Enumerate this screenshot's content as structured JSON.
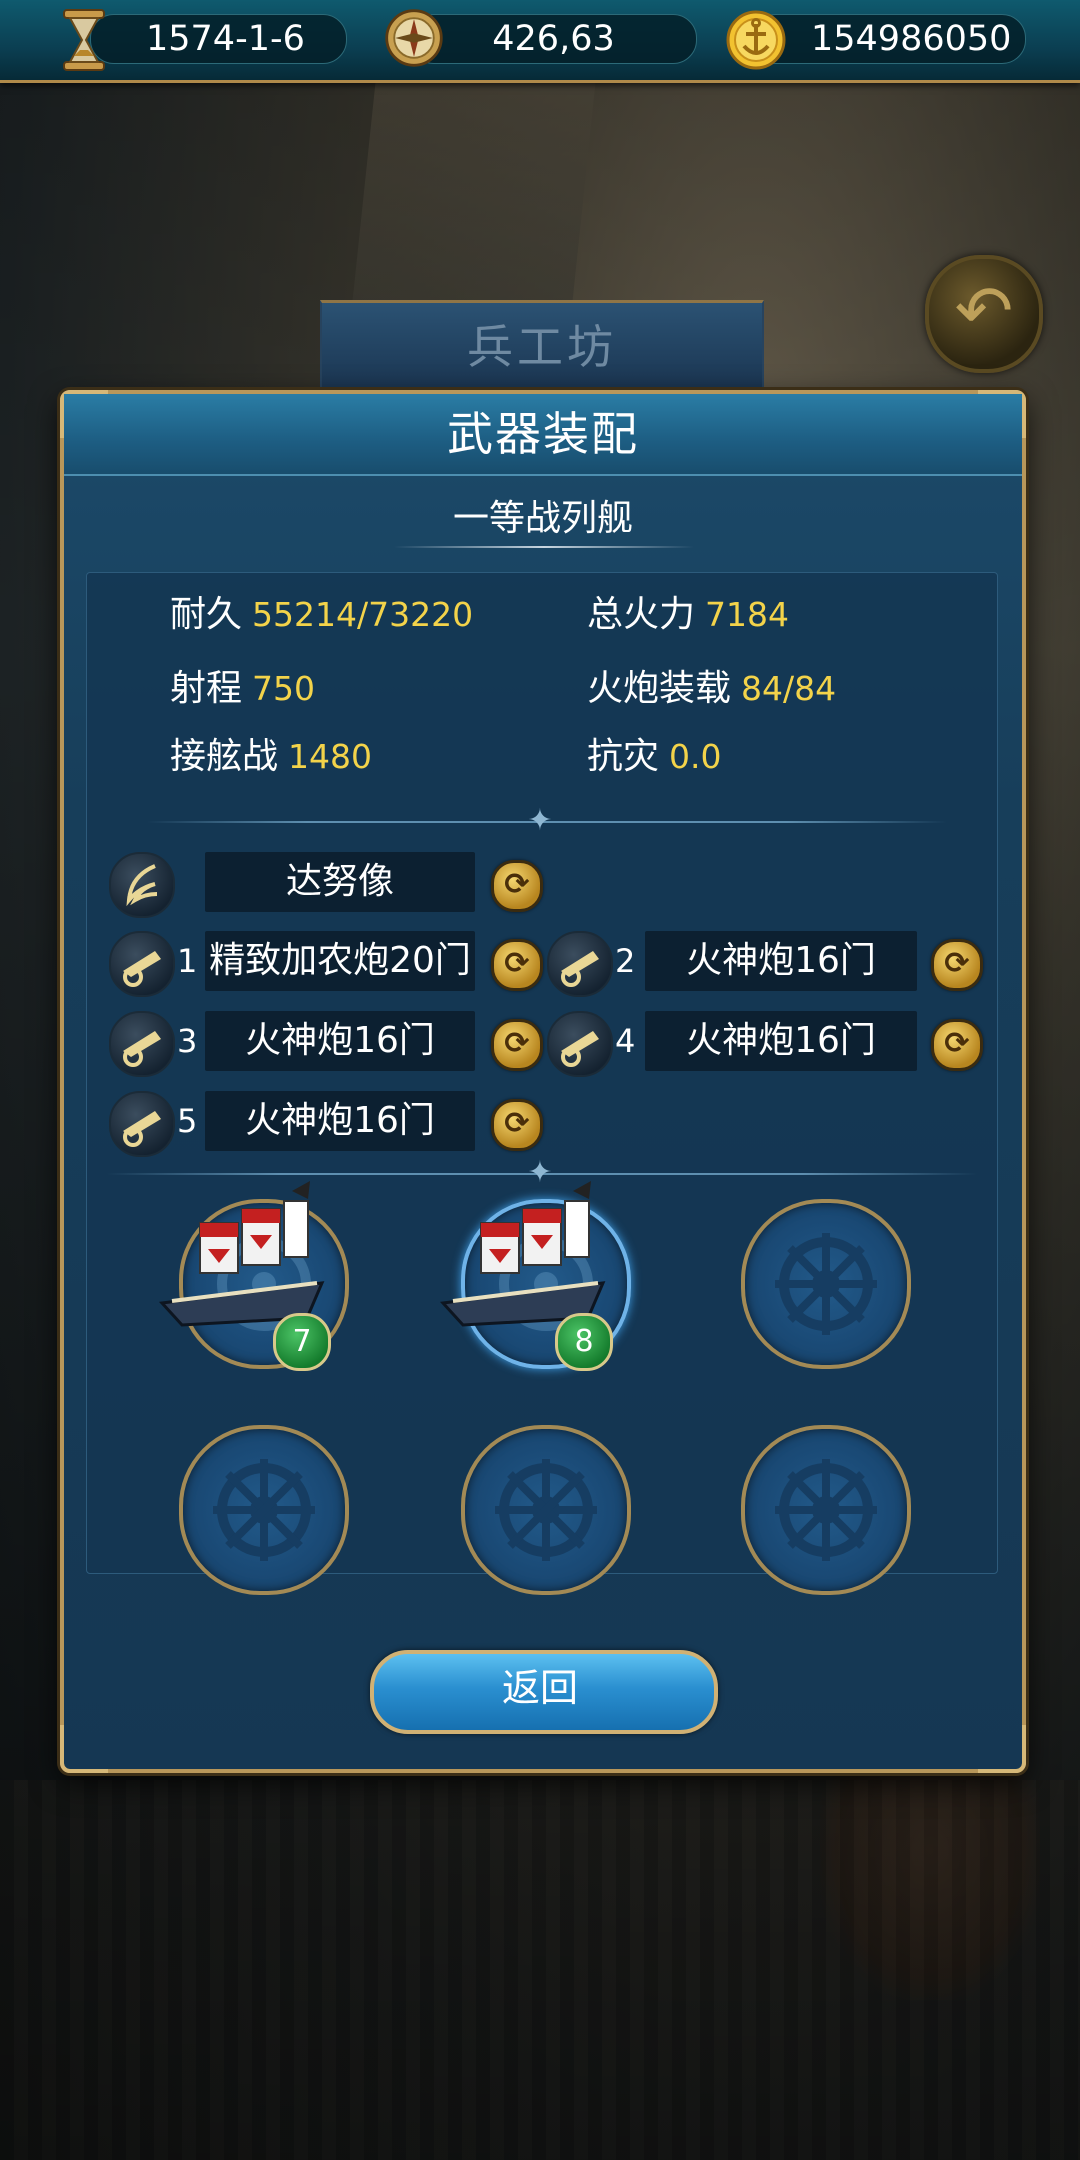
{
  "background": {
    "building_label": "兵工坊"
  },
  "topbar": {
    "date": "1574-1-6",
    "coordinates": "426,63",
    "gold": "154986050",
    "icons": [
      "hourglass-icon",
      "compass-icon",
      "gold-coin-icon"
    ]
  },
  "dialog": {
    "title": "武器装配",
    "ship_name": "一等战列舰",
    "stats": {
      "durability_label": "耐久",
      "durability_value": "55214/73220",
      "firepower_label": "总火力",
      "firepower_value": "7184",
      "range_label": "射程",
      "range_value": "750",
      "cannon_load_label": "火炮装载",
      "cannon_load_value": "84/84",
      "boarding_label": "接舷战",
      "boarding_value": "1480",
      "disaster_resist_label": "抗灾",
      "disaster_resist_value": "0.0"
    },
    "figurehead": {
      "name": "达努像",
      "icon": "wing-icon"
    },
    "cannons": [
      {
        "num": "1",
        "name": "精致加农炮20门"
      },
      {
        "num": "2",
        "name": "火神炮16门"
      },
      {
        "num": "3",
        "name": "火神炮16门"
      },
      {
        "num": "4",
        "name": "火神炮16门"
      },
      {
        "num": "5",
        "name": "火神炮16门"
      }
    ],
    "fleet": [
      {
        "level": "7",
        "has_ship": true
      },
      {
        "level": "8",
        "has_ship": true,
        "selected": true
      },
      {
        "has_ship": false
      },
      {
        "has_ship": false
      },
      {
        "has_ship": false
      },
      {
        "has_ship": false
      }
    ],
    "return_label": "返回"
  },
  "colors": {
    "stat_value": "#f3d34a",
    "accent_gold": "#b8975a",
    "panel_blue": "#173e5a",
    "level_badge": "#137a2b"
  }
}
